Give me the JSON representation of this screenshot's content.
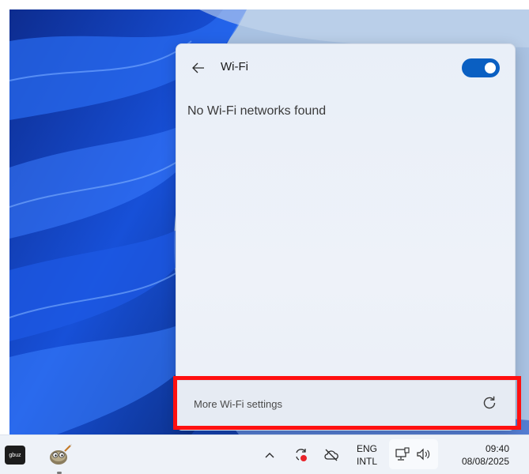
{
  "flyout": {
    "title": "Wi-Fi",
    "wifi_enabled": true,
    "empty_message": "No Wi-Fi networks found",
    "footer_link": "More Wi-Fi settings"
  },
  "taskbar": {
    "app1_label": "gbuz",
    "language_line1": "ENG",
    "language_line2": "INTL",
    "time": "09:40",
    "date": "08/08/2025"
  },
  "colors": {
    "accent": "#0a5fc2",
    "highlight": "#ff1010"
  }
}
